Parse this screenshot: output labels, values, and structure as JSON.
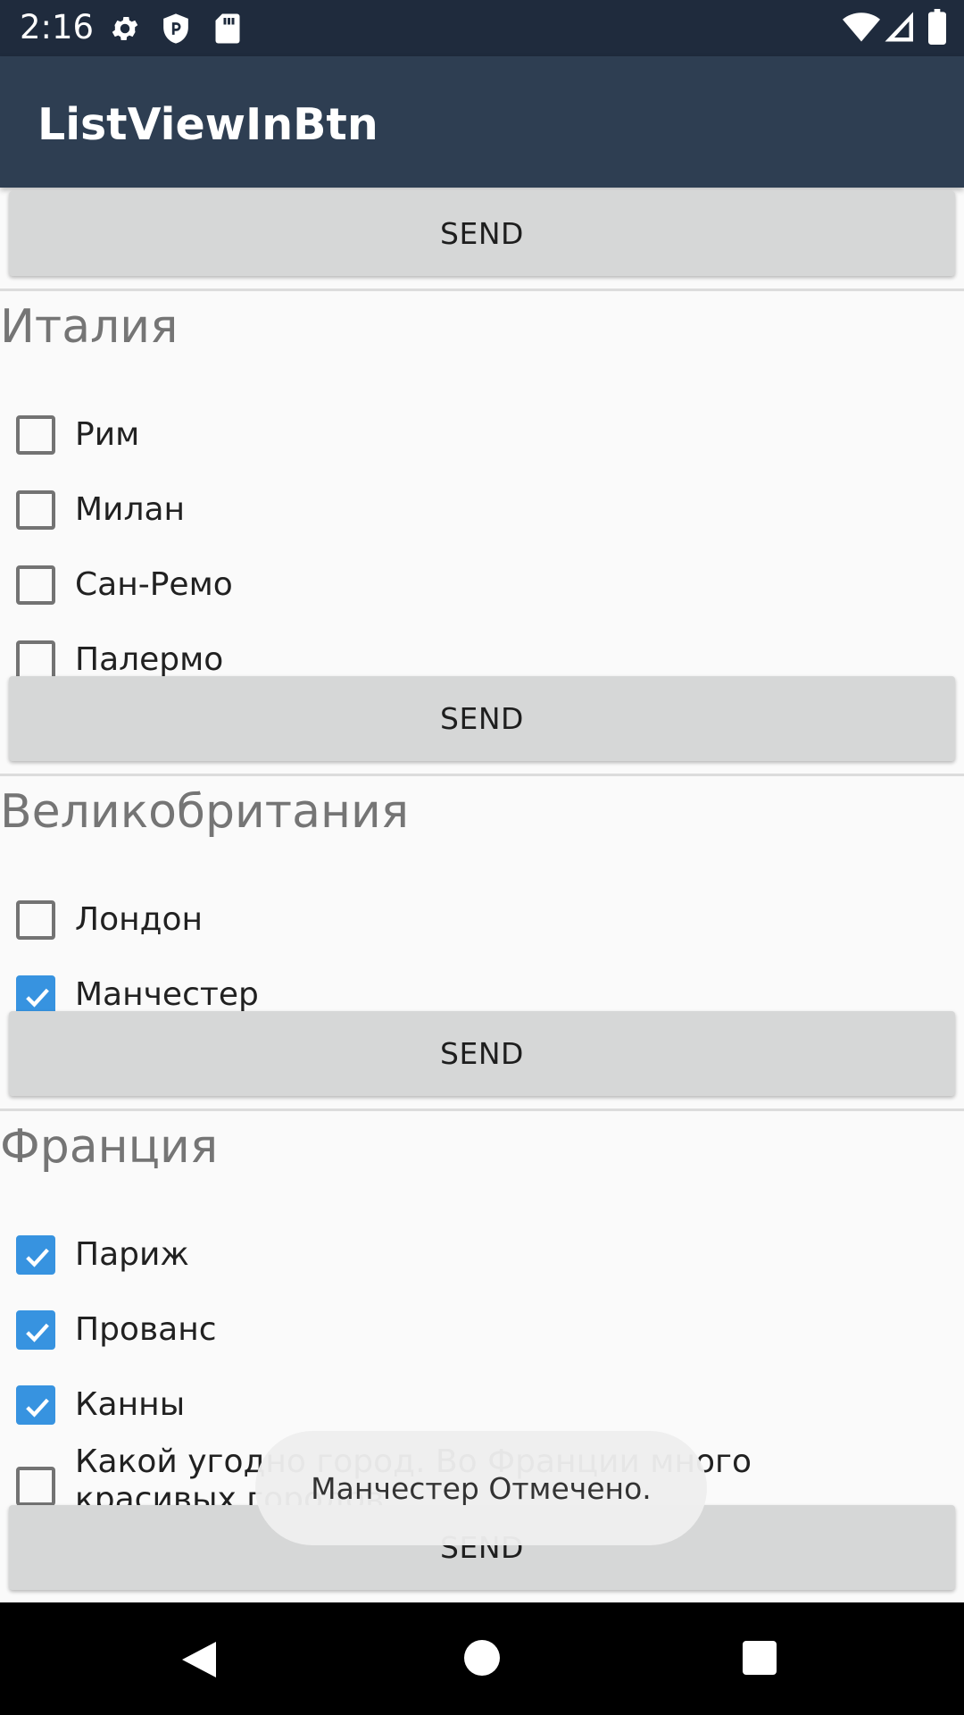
{
  "status_bar": {
    "time": "2:16",
    "icons": [
      "gear-icon",
      "shield-icon",
      "sd-card-icon",
      "wifi-icon",
      "signal-icon",
      "battery-icon"
    ]
  },
  "app_bar": {
    "title": "ListViewInBtn"
  },
  "send_label": "SEND",
  "groups": [
    {
      "country": "Италия",
      "items": [
        {
          "label": "Рим",
          "checked": false
        },
        {
          "label": "Милан",
          "checked": false
        },
        {
          "label": "Сан-Ремо",
          "checked": false
        },
        {
          "label": "Палермо",
          "checked": false
        }
      ]
    },
    {
      "country": "Великобритания",
      "items": [
        {
          "label": "Лондон",
          "checked": false
        },
        {
          "label": "Манчестер",
          "checked": true
        }
      ]
    },
    {
      "country": "Франция",
      "items": [
        {
          "label": "Париж",
          "checked": true
        },
        {
          "label": "Прованс",
          "checked": true
        },
        {
          "label": "Канны",
          "checked": true
        },
        {
          "label": "Какой угодно город. Во Франции много красивых городов.",
          "checked": false
        }
      ]
    }
  ],
  "toast": {
    "message": "Манчестер Отмечено."
  },
  "colors": {
    "status_bar": "#1f2b3d",
    "app_bar": "#2e3e52",
    "checkbox_checked": "#3793e0",
    "button": "#d6d7d7"
  },
  "nav_bar": {
    "buttons": [
      "back-icon",
      "home-icon",
      "recents-icon"
    ]
  }
}
